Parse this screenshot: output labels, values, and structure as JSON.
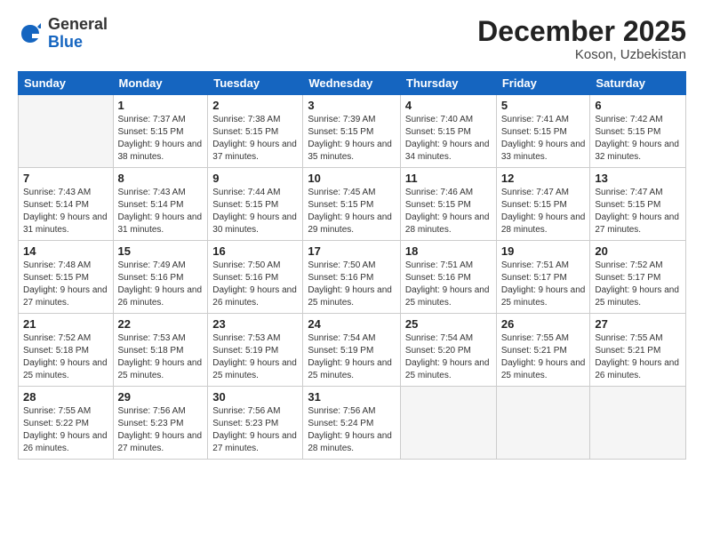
{
  "logo": {
    "general": "General",
    "blue": "Blue"
  },
  "header": {
    "month": "December 2025",
    "location": "Koson, Uzbekistan"
  },
  "weekdays": [
    "Sunday",
    "Monday",
    "Tuesday",
    "Wednesday",
    "Thursday",
    "Friday",
    "Saturday"
  ],
  "weeks": [
    [
      {
        "day": "",
        "empty": true
      },
      {
        "day": "1",
        "sunrise": "Sunrise: 7:37 AM",
        "sunset": "Sunset: 5:15 PM",
        "daylight": "Daylight: 9 hours and 38 minutes."
      },
      {
        "day": "2",
        "sunrise": "Sunrise: 7:38 AM",
        "sunset": "Sunset: 5:15 PM",
        "daylight": "Daylight: 9 hours and 37 minutes."
      },
      {
        "day": "3",
        "sunrise": "Sunrise: 7:39 AM",
        "sunset": "Sunset: 5:15 PM",
        "daylight": "Daylight: 9 hours and 35 minutes."
      },
      {
        "day": "4",
        "sunrise": "Sunrise: 7:40 AM",
        "sunset": "Sunset: 5:15 PM",
        "daylight": "Daylight: 9 hours and 34 minutes."
      },
      {
        "day": "5",
        "sunrise": "Sunrise: 7:41 AM",
        "sunset": "Sunset: 5:15 PM",
        "daylight": "Daylight: 9 hours and 33 minutes."
      },
      {
        "day": "6",
        "sunrise": "Sunrise: 7:42 AM",
        "sunset": "Sunset: 5:15 PM",
        "daylight": "Daylight: 9 hours and 32 minutes."
      }
    ],
    [
      {
        "day": "7",
        "sunrise": "Sunrise: 7:43 AM",
        "sunset": "Sunset: 5:14 PM",
        "daylight": "Daylight: 9 hours and 31 minutes."
      },
      {
        "day": "8",
        "sunrise": "Sunrise: 7:43 AM",
        "sunset": "Sunset: 5:14 PM",
        "daylight": "Daylight: 9 hours and 31 minutes."
      },
      {
        "day": "9",
        "sunrise": "Sunrise: 7:44 AM",
        "sunset": "Sunset: 5:15 PM",
        "daylight": "Daylight: 9 hours and 30 minutes."
      },
      {
        "day": "10",
        "sunrise": "Sunrise: 7:45 AM",
        "sunset": "Sunset: 5:15 PM",
        "daylight": "Daylight: 9 hours and 29 minutes."
      },
      {
        "day": "11",
        "sunrise": "Sunrise: 7:46 AM",
        "sunset": "Sunset: 5:15 PM",
        "daylight": "Daylight: 9 hours and 28 minutes."
      },
      {
        "day": "12",
        "sunrise": "Sunrise: 7:47 AM",
        "sunset": "Sunset: 5:15 PM",
        "daylight": "Daylight: 9 hours and 28 minutes."
      },
      {
        "day": "13",
        "sunrise": "Sunrise: 7:47 AM",
        "sunset": "Sunset: 5:15 PM",
        "daylight": "Daylight: 9 hours and 27 minutes."
      }
    ],
    [
      {
        "day": "14",
        "sunrise": "Sunrise: 7:48 AM",
        "sunset": "Sunset: 5:15 PM",
        "daylight": "Daylight: 9 hours and 27 minutes."
      },
      {
        "day": "15",
        "sunrise": "Sunrise: 7:49 AM",
        "sunset": "Sunset: 5:16 PM",
        "daylight": "Daylight: 9 hours and 26 minutes."
      },
      {
        "day": "16",
        "sunrise": "Sunrise: 7:50 AM",
        "sunset": "Sunset: 5:16 PM",
        "daylight": "Daylight: 9 hours and 26 minutes."
      },
      {
        "day": "17",
        "sunrise": "Sunrise: 7:50 AM",
        "sunset": "Sunset: 5:16 PM",
        "daylight": "Daylight: 9 hours and 25 minutes."
      },
      {
        "day": "18",
        "sunrise": "Sunrise: 7:51 AM",
        "sunset": "Sunset: 5:16 PM",
        "daylight": "Daylight: 9 hours and 25 minutes."
      },
      {
        "day": "19",
        "sunrise": "Sunrise: 7:51 AM",
        "sunset": "Sunset: 5:17 PM",
        "daylight": "Daylight: 9 hours and 25 minutes."
      },
      {
        "day": "20",
        "sunrise": "Sunrise: 7:52 AM",
        "sunset": "Sunset: 5:17 PM",
        "daylight": "Daylight: 9 hours and 25 minutes."
      }
    ],
    [
      {
        "day": "21",
        "sunrise": "Sunrise: 7:52 AM",
        "sunset": "Sunset: 5:18 PM",
        "daylight": "Daylight: 9 hours and 25 minutes."
      },
      {
        "day": "22",
        "sunrise": "Sunrise: 7:53 AM",
        "sunset": "Sunset: 5:18 PM",
        "daylight": "Daylight: 9 hours and 25 minutes."
      },
      {
        "day": "23",
        "sunrise": "Sunrise: 7:53 AM",
        "sunset": "Sunset: 5:19 PM",
        "daylight": "Daylight: 9 hours and 25 minutes."
      },
      {
        "day": "24",
        "sunrise": "Sunrise: 7:54 AM",
        "sunset": "Sunset: 5:19 PM",
        "daylight": "Daylight: 9 hours and 25 minutes."
      },
      {
        "day": "25",
        "sunrise": "Sunrise: 7:54 AM",
        "sunset": "Sunset: 5:20 PM",
        "daylight": "Daylight: 9 hours and 25 minutes."
      },
      {
        "day": "26",
        "sunrise": "Sunrise: 7:55 AM",
        "sunset": "Sunset: 5:21 PM",
        "daylight": "Daylight: 9 hours and 25 minutes."
      },
      {
        "day": "27",
        "sunrise": "Sunrise: 7:55 AM",
        "sunset": "Sunset: 5:21 PM",
        "daylight": "Daylight: 9 hours and 26 minutes."
      }
    ],
    [
      {
        "day": "28",
        "sunrise": "Sunrise: 7:55 AM",
        "sunset": "Sunset: 5:22 PM",
        "daylight": "Daylight: 9 hours and 26 minutes."
      },
      {
        "day": "29",
        "sunrise": "Sunrise: 7:56 AM",
        "sunset": "Sunset: 5:23 PM",
        "daylight": "Daylight: 9 hours and 27 minutes."
      },
      {
        "day": "30",
        "sunrise": "Sunrise: 7:56 AM",
        "sunset": "Sunset: 5:23 PM",
        "daylight": "Daylight: 9 hours and 27 minutes."
      },
      {
        "day": "31",
        "sunrise": "Sunrise: 7:56 AM",
        "sunset": "Sunset: 5:24 PM",
        "daylight": "Daylight: 9 hours and 28 minutes."
      },
      {
        "day": "",
        "empty": true
      },
      {
        "day": "",
        "empty": true
      },
      {
        "day": "",
        "empty": true
      }
    ]
  ]
}
